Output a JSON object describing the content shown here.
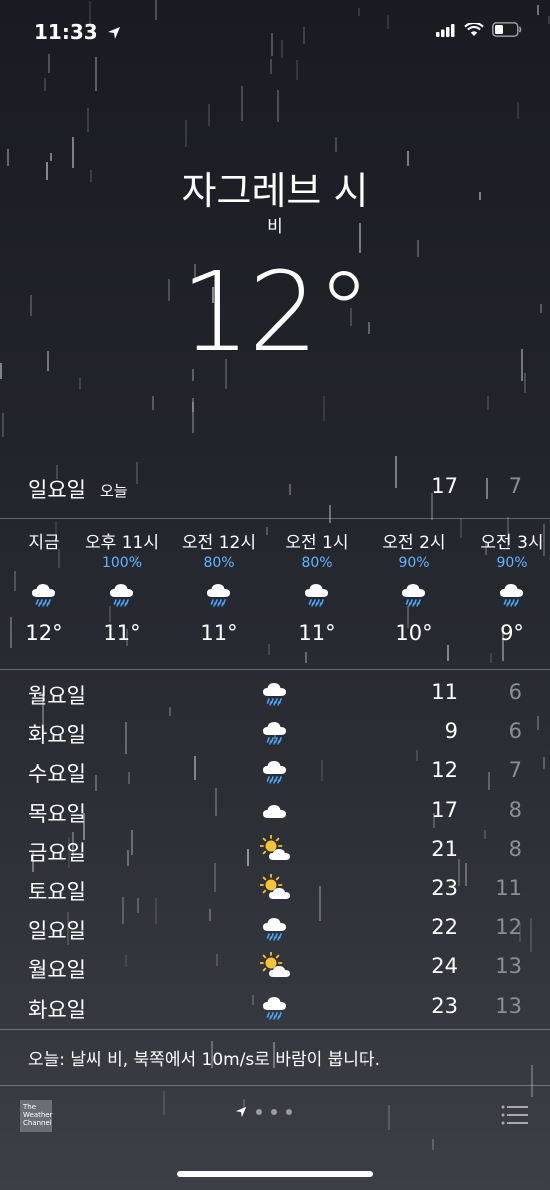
{
  "status_bar": {
    "time": "11:33"
  },
  "location": {
    "city": "자그레브 시",
    "condition": "비",
    "temperature": "12°"
  },
  "today": {
    "day": "일요일",
    "tag": "오늘",
    "high": "17",
    "low": "7"
  },
  "hourly": [
    {
      "time": "지금",
      "prob": "",
      "icon": "rain-cloud-icon",
      "temp": "12°"
    },
    {
      "time": "오후 11시",
      "prob": "100%",
      "icon": "rain-cloud-icon",
      "temp": "11°"
    },
    {
      "time": "오전 12시",
      "prob": "80%",
      "icon": "rain-cloud-icon",
      "temp": "11°"
    },
    {
      "time": "오전 1시",
      "prob": "80%",
      "icon": "rain-cloud-icon",
      "temp": "11°"
    },
    {
      "time": "오전 2시",
      "prob": "90%",
      "icon": "rain-cloud-icon",
      "temp": "10°"
    },
    {
      "time": "오전 3시",
      "prob": "90%",
      "icon": "rain-cloud-icon",
      "temp": "9°"
    }
  ],
  "daily": [
    {
      "day": "월요일",
      "icon": "rain-cloud-icon",
      "high": "11",
      "low": "6"
    },
    {
      "day": "화요일",
      "icon": "rain-cloud-icon",
      "high": "9",
      "low": "6"
    },
    {
      "day": "수요일",
      "icon": "rain-cloud-icon",
      "high": "12",
      "low": "7"
    },
    {
      "day": "목요일",
      "icon": "cloud-icon",
      "high": "17",
      "low": "8"
    },
    {
      "day": "금요일",
      "icon": "partly-cloudy-icon",
      "high": "21",
      "low": "8"
    },
    {
      "day": "토요일",
      "icon": "partly-cloudy-icon",
      "high": "23",
      "low": "11"
    },
    {
      "day": "일요일",
      "icon": "rain-cloud-icon",
      "high": "22",
      "low": "12"
    },
    {
      "day": "월요일",
      "icon": "partly-cloudy-icon",
      "high": "24",
      "low": "13"
    },
    {
      "day": "화요일",
      "icon": "rain-cloud-icon",
      "high": "23",
      "low": "13"
    }
  ],
  "summary": "오늘: 날씨 비, 북쪽에서 10m/s로 바람이 붑니다.",
  "footer": {
    "logo_text": "The Weather Channel",
    "pages": 4
  },
  "colors": {
    "precip": "#5fb6ff",
    "low_temp": "#8d8f96",
    "rain_drop": "#4aa8ff"
  }
}
